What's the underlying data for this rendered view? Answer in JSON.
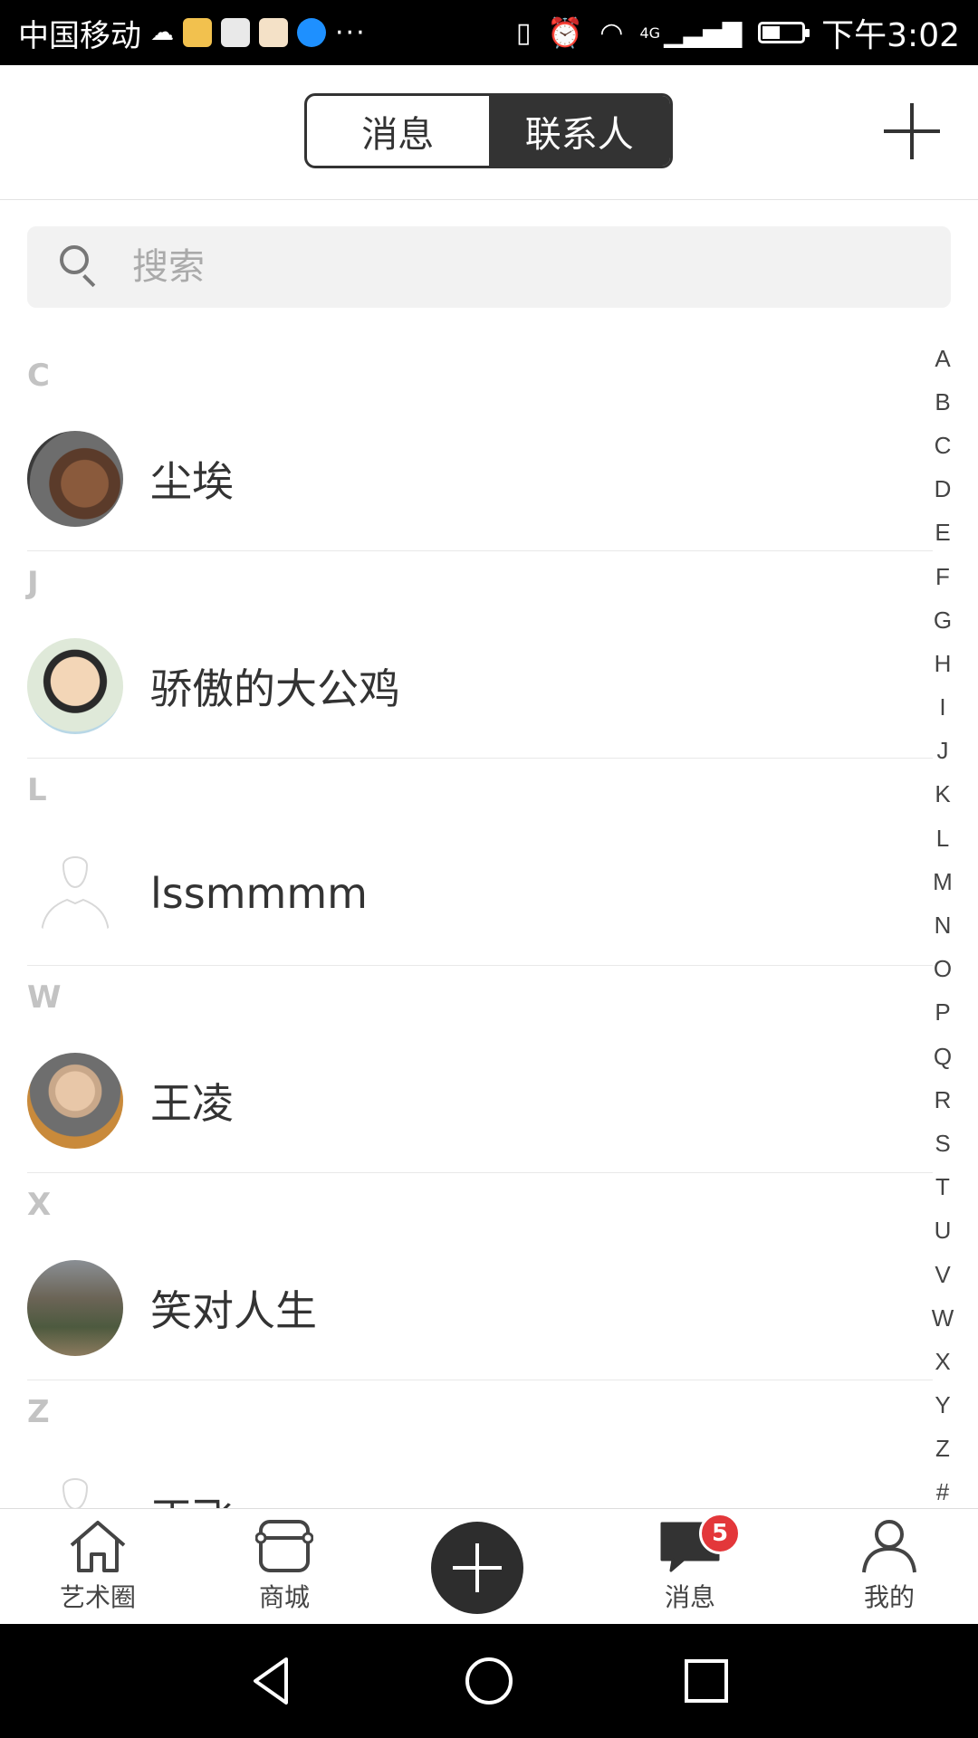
{
  "status_bar": {
    "carrier": "中国移动",
    "dots": "···",
    "network": "4G",
    "time": "下午3:02",
    "battery_level": 0.4
  },
  "header": {
    "tabs": [
      {
        "label": "消息",
        "active": false
      },
      {
        "label": "联系人",
        "active": true
      }
    ],
    "add_icon": "plus-icon"
  },
  "search": {
    "placeholder": "搜索",
    "value": ""
  },
  "contacts": {
    "sections": [
      {
        "letter": "C",
        "items": [
          {
            "name": "尘埃",
            "avatar": "photo-dog"
          }
        ]
      },
      {
        "letter": "J",
        "items": [
          {
            "name": "骄傲的大公鸡",
            "avatar": "cartoon-face"
          }
        ]
      },
      {
        "letter": "L",
        "items": [
          {
            "name": "lssmmmm",
            "avatar": "default-silhouette"
          }
        ]
      },
      {
        "letter": "W",
        "items": [
          {
            "name": "王凌",
            "avatar": "photo-person"
          }
        ]
      },
      {
        "letter": "X",
        "items": [
          {
            "name": "笑对人生",
            "avatar": "photo-building"
          }
        ]
      },
      {
        "letter": "Z",
        "items": [
          {
            "name": "正飞",
            "avatar": "default-silhouette"
          }
        ]
      }
    ]
  },
  "index_bar": [
    "A",
    "B",
    "C",
    "D",
    "E",
    "F",
    "G",
    "H",
    "I",
    "J",
    "K",
    "L",
    "M",
    "N",
    "O",
    "P",
    "Q",
    "R",
    "S",
    "T",
    "U",
    "V",
    "W",
    "X",
    "Y",
    "Z",
    "#"
  ],
  "tab_bar": {
    "items": [
      {
        "label": "艺术圈",
        "icon": "home-icon"
      },
      {
        "label": "商城",
        "icon": "shop-icon"
      },
      {
        "label": "",
        "icon": "plus-icon"
      },
      {
        "label": "消息",
        "icon": "chat-icon",
        "badge": "5"
      },
      {
        "label": "我的",
        "icon": "user-icon"
      }
    ]
  },
  "colors": {
    "primary_dark": "#333333",
    "badge_red": "#e3373a",
    "section_letter": "#c3c3c3",
    "search_bg": "#f2f2f2"
  }
}
